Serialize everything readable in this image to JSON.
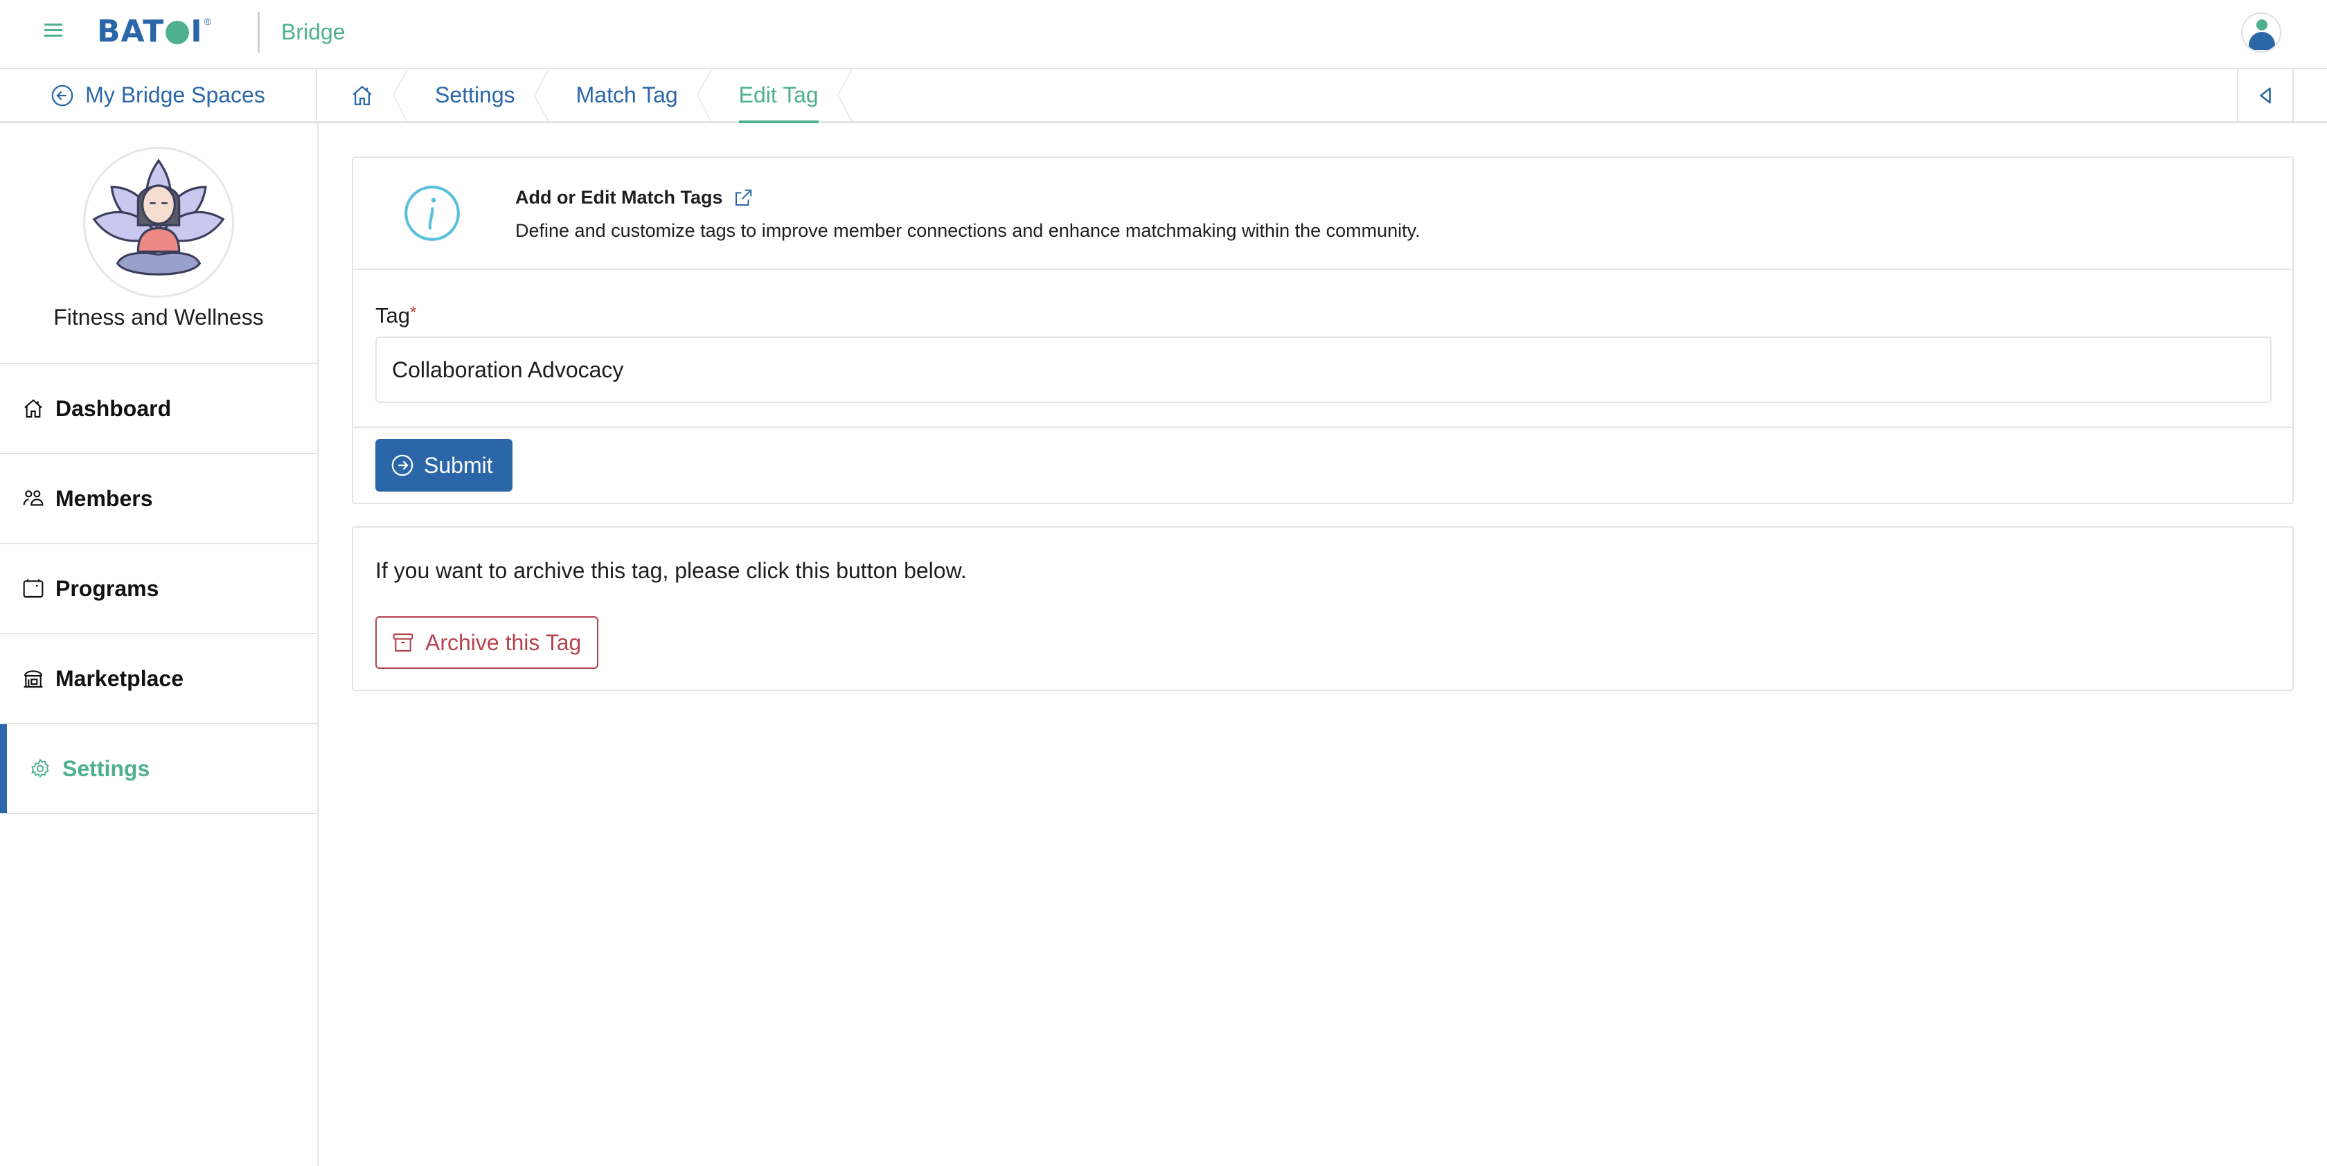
{
  "header": {
    "brand": "BATOI",
    "app_name": "Bridge"
  },
  "subbar": {
    "back_label": "My Bridge Spaces",
    "breadcrumbs": [
      {
        "label": "Settings"
      },
      {
        "label": "Match Tag"
      },
      {
        "label": "Edit Tag"
      }
    ]
  },
  "sidebar": {
    "space_name": "Fitness and Wellness",
    "items": [
      {
        "label": "Dashboard",
        "icon": "home-icon"
      },
      {
        "label": "Members",
        "icon": "users-icon"
      },
      {
        "label": "Programs",
        "icon": "calendar-icon"
      },
      {
        "label": "Marketplace",
        "icon": "store-icon"
      },
      {
        "label": "Settings",
        "icon": "gear-icon",
        "active": true
      }
    ]
  },
  "info": {
    "title": "Add or Edit Match Tags",
    "description": "Define and customize tags to improve member connections and enhance matchmaking within the community."
  },
  "form": {
    "tag_label": "Tag",
    "required_mark": "*",
    "tag_value": "Collaboration Advocacy",
    "submit_label": "Submit"
  },
  "archive": {
    "text": "If you want to archive this tag, please click this button below.",
    "button_label": "Archive this Tag"
  },
  "colors": {
    "primary": "#2b67a8",
    "accent": "#4fb08e",
    "danger": "#b5424f",
    "info": "#5bc0de"
  }
}
